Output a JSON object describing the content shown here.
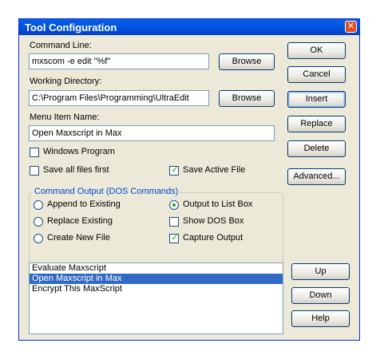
{
  "window": {
    "title": "Tool Configuration",
    "close_glyph": "✕"
  },
  "command_line": {
    "label": "Command Line:",
    "value": "mxscom -e edit \"%f\"",
    "browse": "Browse"
  },
  "working_directory": {
    "label": "Working Directory:",
    "value": "C:\\Program Files\\Programming\\UltraEdit",
    "browse": "Browse"
  },
  "menu_item": {
    "label": "Menu Item Name:",
    "value": "Open Maxscript in Max"
  },
  "options": {
    "windows_program": {
      "label": "Windows Program",
      "checked": false
    },
    "save_all_files_first": {
      "label": "Save all files first",
      "checked": false
    },
    "save_active_file": {
      "label": "Save Active File",
      "checked": true
    }
  },
  "command_output": {
    "title": "Command Output (DOS Commands)",
    "append_to_existing": {
      "label": "Append to Existing",
      "selected": false
    },
    "replace_existing": {
      "label": "Replace Existing",
      "selected": false
    },
    "create_new_file": {
      "label": "Create New File",
      "selected": false
    },
    "output_to_list_box": {
      "label": "Output to List Box",
      "selected": true
    },
    "show_dos_box": {
      "label": "Show DOS Box",
      "checked": false
    },
    "capture_output": {
      "label": "Capture Output",
      "checked": true
    }
  },
  "right_buttons": {
    "ok": "OK",
    "cancel": "Cancel",
    "insert": "Insert",
    "replace": "Replace",
    "delete": "Delete",
    "advanced": "Advanced..."
  },
  "tool_list": {
    "items": [
      "Evaluate Maxscript",
      "Open Maxscript in Max",
      "Encrypt This MaxScript"
    ],
    "selected": "Open Maxscript in Max"
  },
  "list_buttons": {
    "up": "Up",
    "down": "Down",
    "help": "Help"
  },
  "colors": {
    "title_bar": "#0055e5",
    "check_mark": "#21a121",
    "selection": "#316ac5",
    "group_title": "#0046d5"
  }
}
